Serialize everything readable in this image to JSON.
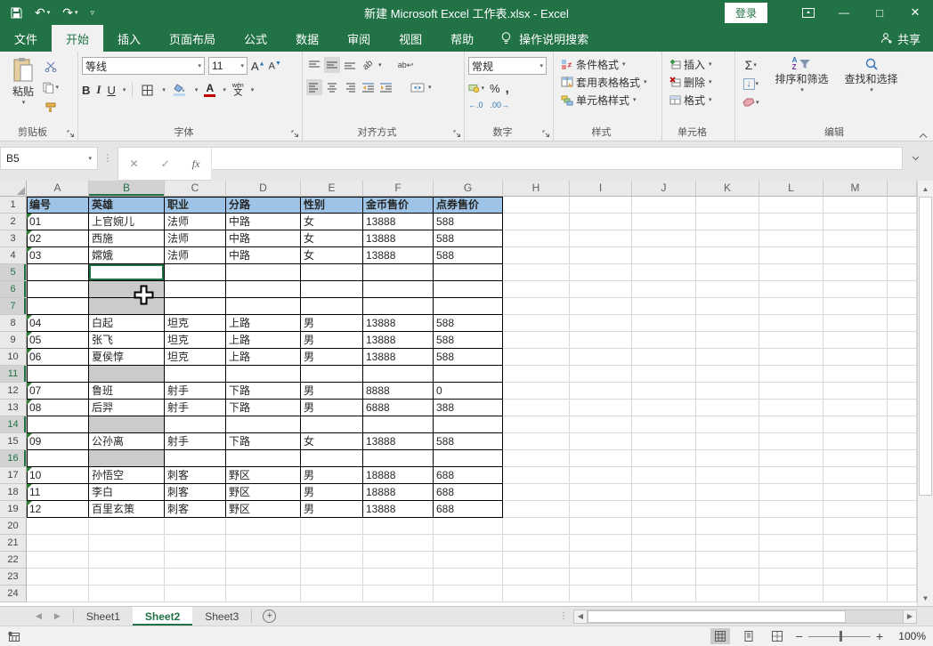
{
  "titlebar": {
    "title": "新建 Microsoft Excel 工作表.xlsx  -  Excel",
    "sign_in": "登录"
  },
  "menu": {
    "file": "文件",
    "tabs": [
      "开始",
      "插入",
      "页面布局",
      "公式",
      "数据",
      "审阅",
      "视图",
      "帮助"
    ],
    "active_tab": "开始",
    "search": "操作说明搜索",
    "share": "共享"
  },
  "ribbon": {
    "clipboard": {
      "label": "剪贴板",
      "paste": "粘贴"
    },
    "font": {
      "label": "字体",
      "name": "等线",
      "size": "11",
      "bold": "B",
      "italic": "I",
      "underline": "U",
      "grow": "A",
      "shrink": "A",
      "color_letter": "A",
      "pinyin_top": "wén",
      "pinyin_bottom": "文"
    },
    "alignment": {
      "label": "对齐方式",
      "wrap": "ab",
      "orient": "ab"
    },
    "number": {
      "label": "数字",
      "format": "常规",
      "percent": "%",
      "comma": ",",
      "inc_decimal": "←.0",
      "dec_decimal": ".00→"
    },
    "styles": {
      "label": "样式",
      "items": [
        "条件格式",
        "套用表格格式",
        "单元格样式"
      ]
    },
    "cells": {
      "label": "单元格",
      "items": [
        "插入",
        "删除",
        "格式"
      ]
    },
    "editing": {
      "label": "编辑",
      "autosum": "Σ",
      "sort_a": "A",
      "sort_z": "Z",
      "sort": "排序和筛选",
      "find": "查找和选择"
    }
  },
  "formula_bar": {
    "name_box": "B5",
    "cancel": "✕",
    "enter": "✓",
    "fx": "fx",
    "value": ""
  },
  "grid": {
    "col_letters": [
      "A",
      "B",
      "C",
      "D",
      "E",
      "F",
      "G",
      "H",
      "I",
      "J",
      "K",
      "L",
      "M"
    ],
    "total_rows": 24,
    "table_rows": 19,
    "table_cols": 7,
    "selected_col_index": 1,
    "selected_rows": [
      5,
      6,
      7,
      11,
      14,
      16
    ],
    "active_cell": "B5",
    "gray_rows": [
      6,
      7,
      11,
      14,
      16
    ],
    "rows": {
      "1": {
        "header": true,
        "cells": [
          "编号",
          "英雄",
          "职业",
          "分路",
          "性别",
          "金币售价",
          "点券售价"
        ]
      },
      "2": {
        "tri": true,
        "cells": [
          "01",
          "上官婉儿",
          "法师",
          "中路",
          "女",
          "13888",
          "588"
        ]
      },
      "3": {
        "tri": true,
        "cells": [
          "02",
          "西施",
          "法师",
          "中路",
          "女",
          "13888",
          "588"
        ]
      },
      "4": {
        "tri": true,
        "cells": [
          "03",
          "嫦娥",
          "法师",
          "中路",
          "女",
          "13888",
          "588"
        ]
      },
      "8": {
        "tri": true,
        "cells": [
          "04",
          "白起",
          "坦克",
          "上路",
          "男",
          "13888",
          "588"
        ]
      },
      "9": {
        "tri": true,
        "cells": [
          "05",
          "张飞",
          "坦克",
          "上路",
          "男",
          "13888",
          "588"
        ]
      },
      "10": {
        "tri": true,
        "cells": [
          "06",
          "夏侯惇",
          "坦克",
          "上路",
          "男",
          "13888",
          "588"
        ]
      },
      "12": {
        "tri": true,
        "cells": [
          "07",
          "鲁班",
          "射手",
          "下路",
          "男",
          "8888",
          "0"
        ]
      },
      "13": {
        "tri": true,
        "cells": [
          "08",
          "后羿",
          "射手",
          "下路",
          "男",
          "6888",
          "388"
        ]
      },
      "15": {
        "tri": true,
        "cells": [
          "09",
          "公孙离",
          "射手",
          "下路",
          "女",
          "13888",
          "588"
        ]
      },
      "17": {
        "tri": true,
        "cells": [
          "10",
          "孙悟空",
          "刺客",
          "野区",
          "男",
          "18888",
          "688"
        ]
      },
      "18": {
        "tri": true,
        "cells": [
          "11",
          "李白",
          "刺客",
          "野区",
          "男",
          "18888",
          "688"
        ]
      },
      "19": {
        "tri": true,
        "cells": [
          "12",
          "百里玄策",
          "刺客",
          "野区",
          "男",
          "13888",
          "688"
        ]
      }
    }
  },
  "sheet_tabs": {
    "tabs": [
      "Sheet1",
      "Sheet2",
      "Sheet3"
    ],
    "active": "Sheet2"
  },
  "status_bar": {
    "zoom": "100%"
  },
  "colors": {
    "accent": "#217346",
    "header_fill": "#9DC3E6",
    "selection_gray": "#CBCBCB",
    "triangle_green": "#2E7D32",
    "font_color_red": "#C00000",
    "fill_color_blue": "#BDD7EE"
  }
}
